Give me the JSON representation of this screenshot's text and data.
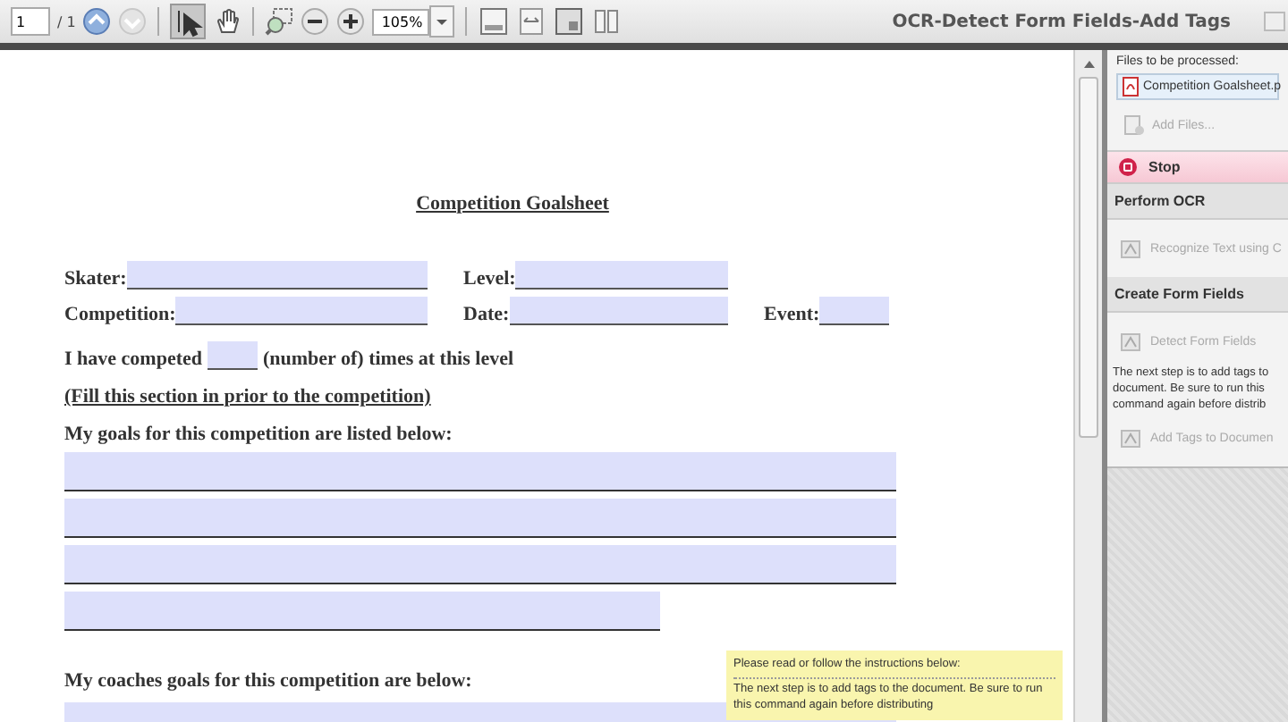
{
  "toolbar": {
    "page_field": "1",
    "page_count": "/ 1",
    "zoom": "105%",
    "title": "OCR-Detect Form Fields-Add Tags"
  },
  "document": {
    "title": "Competition Goalsheet",
    "info_rows": [
      [
        {
          "label": "Skater:"
        },
        {
          "label": "Level:"
        }
      ],
      [
        {
          "label": "Competition:"
        },
        {
          "label": "Date:"
        },
        {
          "label": "Event:"
        }
      ]
    ],
    "competed": {
      "before": "I have competed",
      "after": "(number of) times at this level"
    },
    "instruction": "(Fill this section in prior to the competition)",
    "goals_heading": "My goals for this competition are listed below:",
    "goal_lines": [
      {
        "kind": "full"
      },
      {
        "kind": "full"
      },
      {
        "kind": "full"
      },
      {
        "kind": "short"
      }
    ],
    "coach_heading": "My coaches goals for this competition are below:"
  },
  "tooltip": {
    "heading": "Please read or follow the instructions below:",
    "text": "The next step is to add tags to the document. Be sure to run this command again before distributing"
  },
  "panel": {
    "files_label": "Files to be processed:",
    "file": "Competition Goalsheet.p",
    "add_files": "Add Files...",
    "stop": "Stop",
    "sections": [
      {
        "title": "Perform OCR",
        "items": [
          {
            "kind": "action",
            "text": "Recognize Text using C",
            "disabled": true
          }
        ]
      },
      {
        "title": "Create Form Fields",
        "items": [
          {
            "kind": "action",
            "text": "Detect Form Fields",
            "disabled": true
          },
          {
            "kind": "note",
            "text": "The next step is to add tags to document. Be sure to run this command again before distrib"
          },
          {
            "kind": "action",
            "text": "Add Tags to Documen",
            "disabled": true
          }
        ]
      }
    ]
  }
}
